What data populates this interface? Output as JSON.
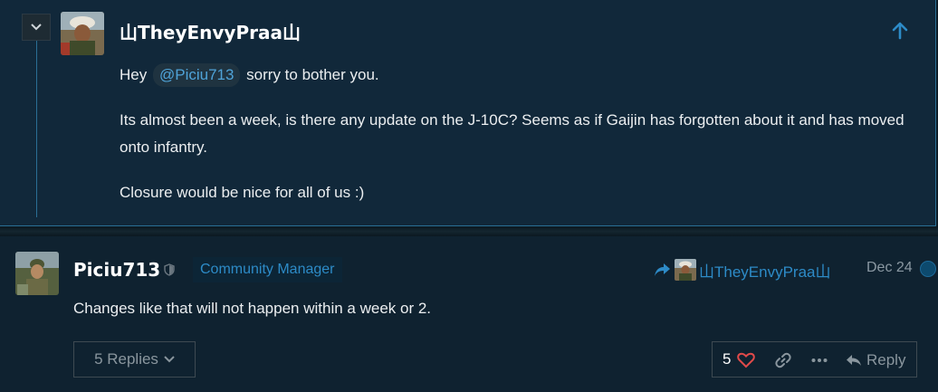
{
  "quoted_post": {
    "username": "山TheyEnvyPraa山",
    "mention": "@Piciu713",
    "line1_before": "Hey",
    "line1_after": "sorry to bother you.",
    "paragraph2": "Its almost been a week, is there any update on the J-10C? Seems as if Gaijin has forgotten about it and has moved onto infantry.",
    "paragraph3": "Closure would be nice for all of us :)"
  },
  "post": {
    "username": "Piciu713",
    "role": "Community Manager",
    "reply_to_username": "山TheyEnvyPraa山",
    "date": "Dec 24",
    "body": "Changes like that will not happen within a week or 2.",
    "replies_label": "5 Replies",
    "like_count": "5",
    "reply_label": "Reply"
  },
  "colors": {
    "accent": "#2d8bc7",
    "heart": "#e04a4a",
    "background": "#0f2230"
  },
  "icons": [
    "chevron-down-icon",
    "arrow-up-icon",
    "shield-icon",
    "reply-arrow-icon",
    "heart-icon",
    "link-icon",
    "more-icon",
    "reply-icon"
  ]
}
